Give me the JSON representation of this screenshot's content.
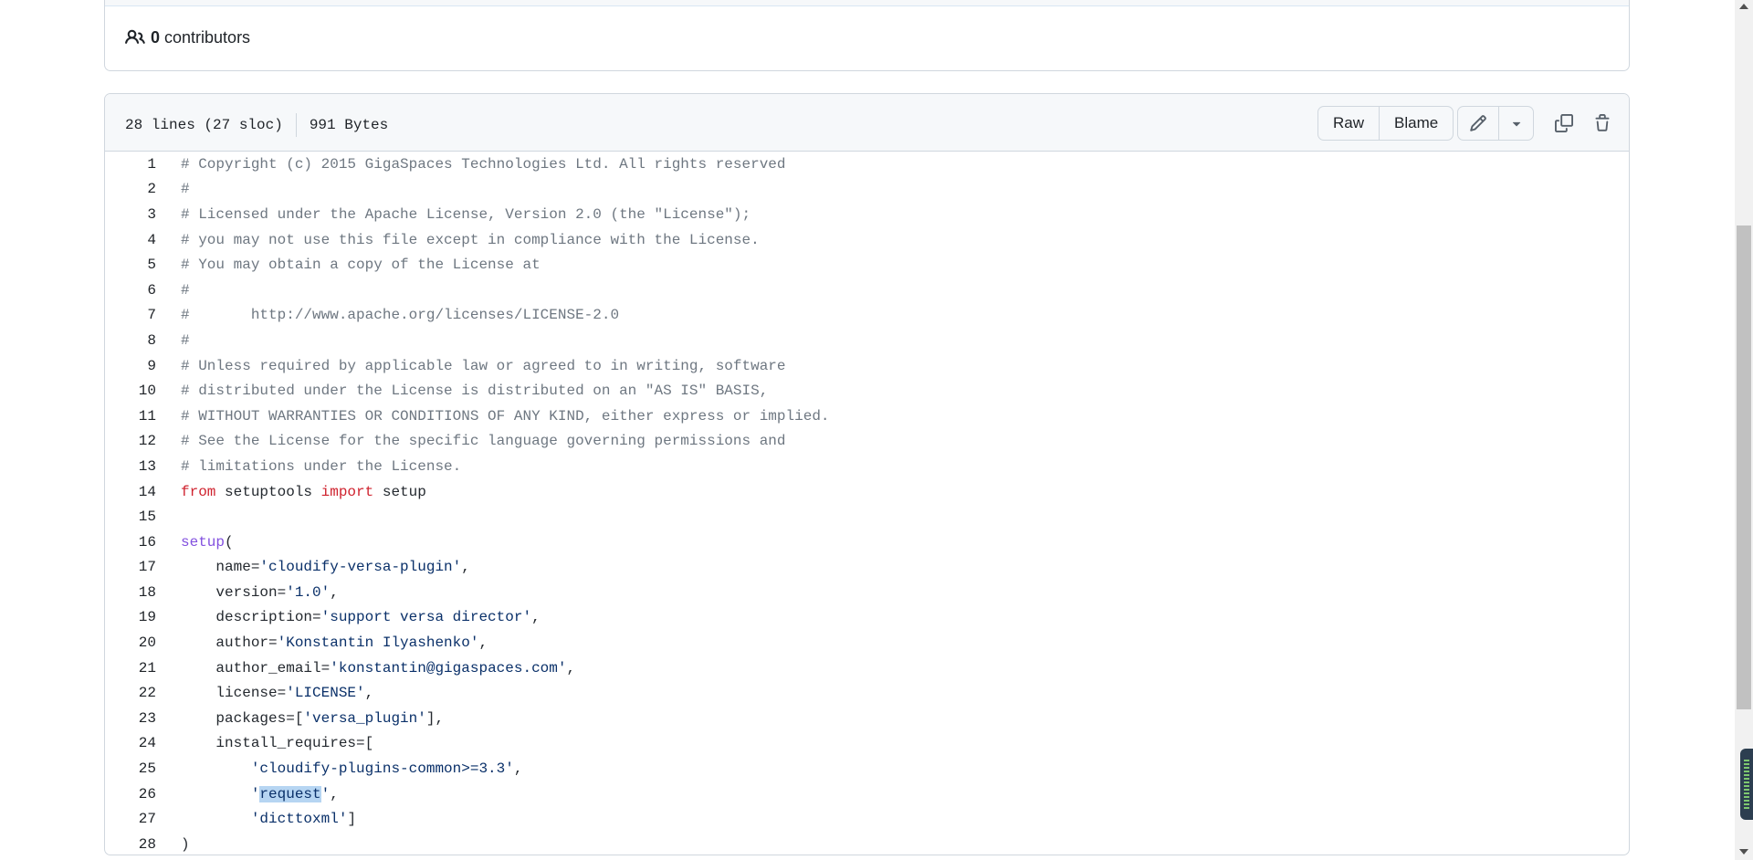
{
  "contributors": {
    "count": "0",
    "label": "contributors",
    "icon": "people-icon"
  },
  "file_header": {
    "lines_info": "28 lines (27 sloc)",
    "size": "991 Bytes",
    "raw_label": "Raw",
    "blame_label": "Blame",
    "edit_icon": "pencil-icon",
    "dropdown_icon": "triangle-down-icon",
    "copy_icon": "copy-icon",
    "delete_icon": "trash-icon"
  },
  "code": {
    "line_numbers": [
      "1",
      "2",
      "3",
      "4",
      "5",
      "6",
      "7",
      "8",
      "9",
      "10",
      "11",
      "12",
      "13",
      "14",
      "15",
      "16",
      "17",
      "18",
      "19",
      "20",
      "21",
      "22",
      "23",
      "24",
      "25",
      "26",
      "27",
      "28"
    ],
    "comments": {
      "l1": "# Copyright (c) 2015 GigaSpaces Technologies Ltd. All rights reserved",
      "l2": "#",
      "l3": "# Licensed under the Apache License, Version 2.0 (the \"License\");",
      "l4": "# you may not use this file except in compliance with the License.",
      "l5": "# You may obtain a copy of the License at",
      "l6": "#",
      "l7": "#       http://www.apache.org/licenses/LICENSE-2.0",
      "l8": "#",
      "l9": "# Unless required by applicable law or agreed to in writing, software",
      "l10": "# distributed under the License is distributed on an \"AS IS\" BASIS,",
      "l11": "# WITHOUT WARRANTIES OR CONDITIONS OF ANY KIND, either express or implied.",
      "l12": "# See the License for the specific language governing permissions and",
      "l13": "# limitations under the License."
    },
    "l14": {
      "kw1": "from",
      "mod": " setuptools ",
      "kw2": "import",
      "name": " setup"
    },
    "l16": {
      "fn": "setup",
      "rest": "("
    },
    "l17": {
      "key": "    name=",
      "val": "'cloudify-versa-plugin'",
      "tail": ","
    },
    "l18": {
      "key": "    version=",
      "val": "'1.0'",
      "tail": ","
    },
    "l19": {
      "key": "    description=",
      "val": "'support versa director'",
      "tail": ","
    },
    "l20": {
      "key": "    author=",
      "val": "'Konstantin Ilyashenko'",
      "tail": ","
    },
    "l21": {
      "key": "    author_email=",
      "val": "'konstantin@gigaspaces.com'",
      "tail": ","
    },
    "l22": {
      "key": "    license=",
      "val": "'LICENSE'",
      "tail": ","
    },
    "l23": {
      "key": "    packages=[",
      "val": "'versa_plugin'",
      "tail": "],"
    },
    "l24": {
      "key": "    install_requires=["
    },
    "l25": {
      "pre": "        ",
      "val": "'cloudify-plugins-common>=3.3'",
      "tail": ","
    },
    "l26": {
      "pre": "        ",
      "q1": "'",
      "sel": "request",
      "q2": "'",
      "tail": ","
    },
    "l27": {
      "pre": "        ",
      "val": "'dicttoxml'",
      "tail": "]"
    },
    "l28": {
      "text": ")"
    }
  },
  "colors": {
    "comment": "#6e7781",
    "keyword": "#cf222e",
    "function": "#8250df",
    "string": "#0a3069",
    "selection": "#b6d5f2"
  }
}
